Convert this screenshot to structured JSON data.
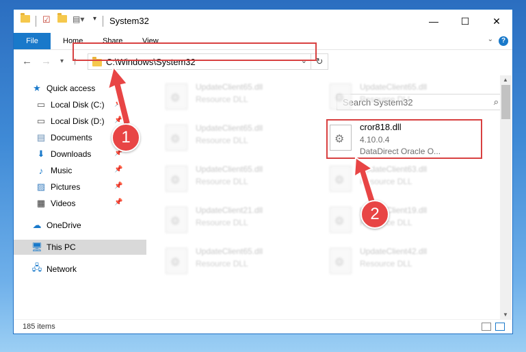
{
  "window": {
    "title": "System32",
    "minimize": "—",
    "maximize": "☐",
    "close": "✕"
  },
  "ribbon": {
    "tabs": [
      "File",
      "Home",
      "Share",
      "View"
    ],
    "help": "?"
  },
  "address": {
    "path": "C:\\Windows\\System32",
    "search_placeholder": "Search System32"
  },
  "sidebar": {
    "items": [
      {
        "label": "Quick access",
        "icon": "star-icon"
      },
      {
        "label": "Local Disk (C:)",
        "icon": "drive-icon",
        "pinned": true
      },
      {
        "label": "Local Disk (D:)",
        "icon": "drive-icon",
        "pinned": true
      },
      {
        "label": "Documents",
        "icon": "documents-icon",
        "pinned": true
      },
      {
        "label": "Downloads",
        "icon": "downloads-icon",
        "pinned": true
      },
      {
        "label": "Music",
        "icon": "music-icon",
        "pinned": true
      },
      {
        "label": "Pictures",
        "icon": "pictures-icon",
        "pinned": true
      },
      {
        "label": "Videos",
        "icon": "videos-icon",
        "pinned": true
      },
      {
        "label": "OneDrive",
        "icon": "cloud-icon"
      },
      {
        "label": "This PC",
        "icon": "computer-icon",
        "selected": true
      },
      {
        "label": "Network",
        "icon": "network-icon"
      }
    ]
  },
  "files": {
    "left_column": [
      {
        "name": "UpdateClient65.dll",
        "desc": "Resource DLL"
      },
      {
        "name": "UpdateClient65.dll",
        "desc": "Resource DLL"
      },
      {
        "name": "UpdateClient65.dll",
        "desc": "Resource DLL"
      },
      {
        "name": "UpdateClient21.dll",
        "desc": "Resource DLL"
      },
      {
        "name": "UpdateClient65.dll",
        "desc": "Resource DLL"
      }
    ],
    "right_column": [
      {
        "name": "UpdateClient65.dll",
        "desc": "Resource DLL"
      },
      {
        "name": "UpdateClient63.dll",
        "desc": "Resource DLL"
      },
      {
        "name": "UpdateClient19.dll",
        "desc": "Resource DLL"
      },
      {
        "name": "UpdateClient42.dll",
        "desc": "Resource DLL"
      }
    ],
    "focused": {
      "name": "cror818.dll",
      "version": "4.10.0.4",
      "desc": "DataDirect Oracle O..."
    }
  },
  "status": {
    "count": "185 items"
  },
  "callouts": [
    "1",
    "2"
  ],
  "colors": {
    "accent": "#1979ca",
    "highlight": "#d84040",
    "badge": "#e84545"
  }
}
